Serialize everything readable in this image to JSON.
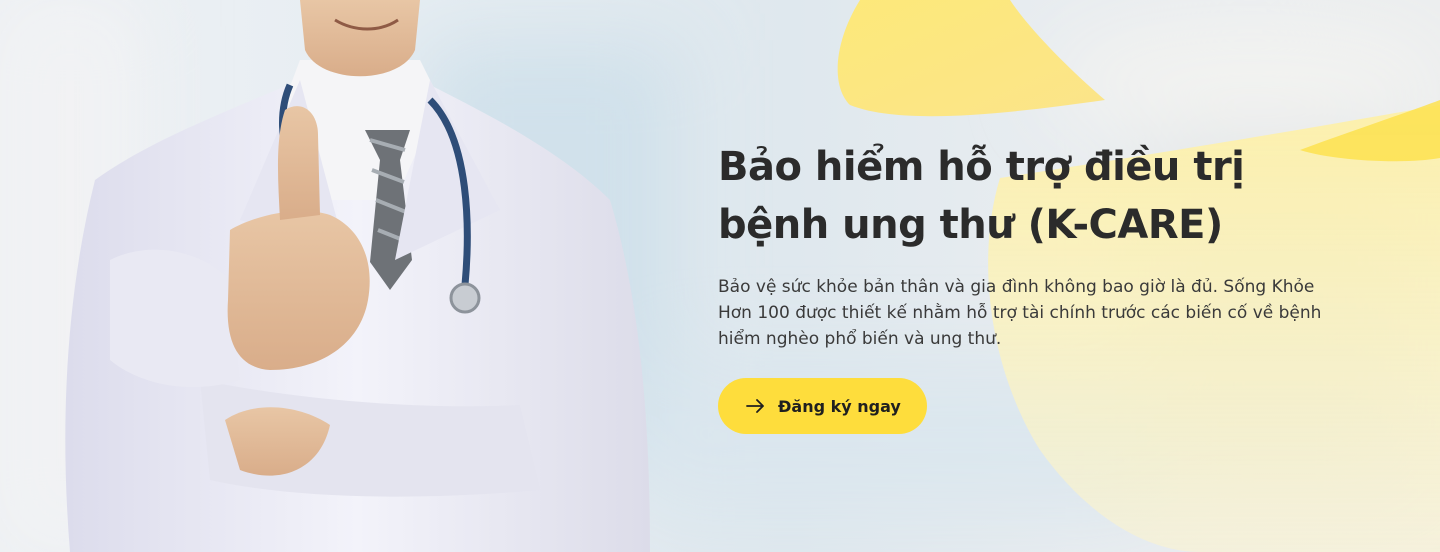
{
  "colors": {
    "accent": "#fedd3c",
    "title": "#2b2b2b",
    "text": "#3a3a3a"
  },
  "hero": {
    "title_line1": "Bảo hiểm hỗ trợ điều trị",
    "title_line2": "bệnh ung thư (K-CARE)",
    "description": "Bảo vệ sức khỏe bản thân và gia đình không bao giờ là đủ. Sống Khỏe Hơn 100 được thiết kế nhằm hỗ trợ tài chính trước các biến cố về bệnh hiểm nghèo phổ biến và ung thư.",
    "cta": {
      "icon": "arrow-right-icon",
      "label": "Đăng ký ngay"
    },
    "image": "doctor-thumbs-up-photo"
  }
}
